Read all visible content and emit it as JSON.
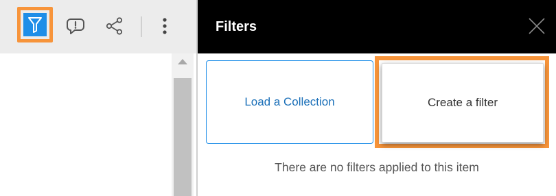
{
  "toolbar": {
    "buttons": [
      {
        "name": "filter",
        "icon": "filter-funnel-icon",
        "active": true
      },
      {
        "name": "comment",
        "icon": "comment-alert-icon"
      },
      {
        "name": "share",
        "icon": "share-icon"
      },
      {
        "name": "more",
        "icon": "kebab-menu-icon"
      }
    ]
  },
  "filters_panel": {
    "title": "Filters",
    "close_icon": "close-icon",
    "load_collection_label": "Load a Collection",
    "create_filter_label": "Create a filter",
    "empty_message": "There are no filters applied to this item"
  },
  "colors": {
    "accent_blue": "#1e8ee8",
    "highlight_orange": "#f7943a",
    "header_black": "#000000",
    "toolbar_gray": "#ececec"
  }
}
